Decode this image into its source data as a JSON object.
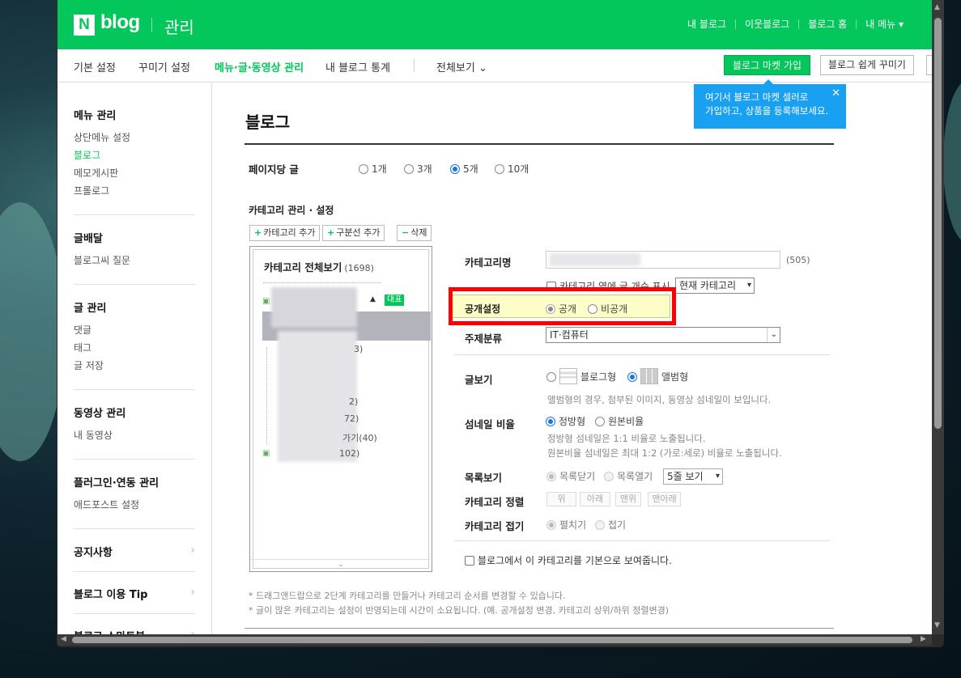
{
  "header": {
    "logo_n": "N",
    "logo_text": "blog",
    "section": "관리",
    "links": [
      "내 블로그",
      "이웃블로그",
      "블로그 홈",
      "내 메뉴 ▾"
    ]
  },
  "tabs": {
    "items": [
      "기본 설정",
      "꾸미기 설정",
      "메뉴·글·동영상 관리",
      "내 블로그 통계",
      "전체보기"
    ],
    "active": "메뉴·글·동영상 관리",
    "market_button": "블로그 마켓 가입",
    "easy_button": "블로그 쉽게 꾸미기"
  },
  "tooltip": {
    "line1": "여기서 블로그 마켓 셀러로",
    "line2": "가입하고, 상품을 등록해보세요.",
    "close": "✕"
  },
  "sidebar": {
    "menu_title": "메뉴 관리",
    "menu_items": [
      "상단메뉴 설정",
      "블로그",
      "메모게시판",
      "프롤로그"
    ],
    "delivery_title": "글배달",
    "delivery_items": [
      "블로그씨 질문"
    ],
    "post_title": "글 관리",
    "post_items": [
      "댓글",
      "태그",
      "글 저장"
    ],
    "video_title": "동영상 관리",
    "video_items": [
      "내 동영상"
    ],
    "plugin_title": "플러그인·연동 관리",
    "plugin_items": [
      "애드포스트 설정"
    ],
    "notice": "공지사항",
    "tip": "블로그 이용 Tip",
    "smart": "블로그 스마트봇"
  },
  "main": {
    "title": "블로그",
    "per_page_label": "페이지당 글",
    "per_page_options": [
      "1개",
      "3개",
      "5개",
      "10개"
    ],
    "per_page_selected": "5개",
    "category_section": "카테고리 관리 · 설정",
    "add_category": "카테고리 추가",
    "add_divider": "구분선 추가",
    "delete": "삭제",
    "category_all": "카테고리 전체보기",
    "category_count": "(1698)",
    "rep_badge": "대표",
    "partial_items": [
      "3)",
      "2)",
      "72)",
      "가기(40)",
      "102)"
    ],
    "category_name_label": "카테고리명",
    "category_name_count": "(505)",
    "show_count_label": "카테고리 옆에 글 개수 표시",
    "current_category": "현재 카테고리",
    "public_label": "공개설정",
    "public": "공개",
    "private": "비공개",
    "topic_label": "주제분류",
    "topic_value": "IT·컴퓨터",
    "view_label": "글보기",
    "view_blog": "블로그형",
    "view_album": "앨범형",
    "view_note": "앨범형의 경우, 첨부된 이미지, 동영상 섬네일이 보입니다.",
    "thumb_label": "섬네일 비율",
    "thumb_square": "정방형",
    "thumb_original": "원본비율",
    "thumb_note1": "정방형 섬네일은 1:1 비율로 노출됩니다.",
    "thumb_note2": "원본비율 섬네일은 최대 1:2 (가로:세로) 비율로 노출됩니다.",
    "list_label": "목록보기",
    "list_close": "목록닫기",
    "list_open": "목록열기",
    "list_rows": "5줄 보기",
    "sort_label": "카테고리 정렬",
    "sort_up": "위",
    "sort_down": "아래",
    "sort_top": "맨위",
    "sort_bottom": "맨아래",
    "fold_label": "카테고리 접기",
    "fold_expand": "펼치기",
    "fold_collapse": "접기",
    "default_show": "블로그에서 이 카테고리를 기본으로 보여줍니다.",
    "foot1": "* 드래그앤드랍으로 2단계 카테고리를 만들거나 카테고리 순서를 변경할 수 있습니다.",
    "foot2": "* 글이 많은 카테고리는 설정이 반영되는데 시간이 소요됩니다. (예. 공개설정 변경, 카테고리 상위/하위 정렬변경)"
  },
  "colors": {
    "brand": "#03c75a",
    "highlight": "#ff0000",
    "tooltip": "#1aa0f0"
  }
}
